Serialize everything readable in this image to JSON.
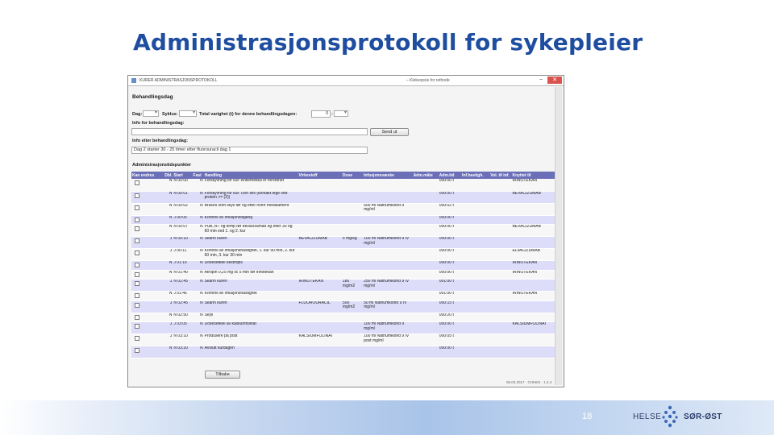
{
  "slide": {
    "title": "Administrasjonsprotokoll for sykepleier",
    "page_number": "18",
    "logo_left": "HELSE",
    "logo_right": "SØR-ØST"
  },
  "window": {
    "title": "KURER ADMINISTRASJONSPROTOKOLL",
    "subtitle": "– Kleksopsis for rethode",
    "minimize": "–",
    "close": "✕"
  },
  "behandlingsdag": {
    "heading": "Behandlingsdag",
    "dag_label": "Dag:",
    "syklus_label": "Syklus:",
    "varighet_label": "Total varighet (t) for denne behandlingsdagen:",
    "varighet_hours": "0",
    "varighet_sep": ":",
    "info_label": "Info for behandlingsdag:",
    "send_button": "Send ut",
    "info_etter_label": "Info etter behandlingsdag:",
    "info_etter_value": "Dag 2 starter 30 - 25 timer etter fluorouracil dag 1"
  },
  "admin": {
    "heading": "Administrasjonstidspunkter",
    "columns": [
      "Kan endres",
      "Dbl.",
      "Start",
      "Fast",
      "Handling",
      "Virkestoff",
      "Dose",
      "Infusjonsvæske",
      "Adm.måte",
      "Adm.tid",
      "Inf.hastigh.",
      "Vol. til inf.",
      "Knyttet til"
    ],
    "rows": [
      {
        "dbl": "N",
        "start": "N 00:00",
        "fast": "N",
        "handling": "Forskyvning for kur: Antiemetika er forordnet",
        "virkestoff": "",
        "dose": "",
        "infusjon": "",
        "admtid": "000:00 t",
        "knyttet": "IRINOTEKAN"
      },
      {
        "dbl": "N",
        "start": "N 00:01",
        "fast": "N",
        "handling": "Forskyvning for kur: Urin stix (kontakt lege ved protein >= (2))",
        "virkestoff": "",
        "dose": "",
        "infusjon": "",
        "admtid": "000:00 t",
        "knyttet": "BEVACIZUMAB"
      },
      {
        "dbl": "N",
        "start": "N 00:02",
        "fast": "N",
        "handling": "Brukes som skyll før og etter hvert medikament",
        "virkestoff": "",
        "dose": "",
        "infusjon": "500 ml Natriumklorid 9 mg/ml",
        "admtid": "000:02 t",
        "knyttet": ""
      },
      {
        "dbl": "N",
        "start": "J 00:05",
        "fast": "N",
        "handling": "Kontroll av infusjonstilgang",
        "virkestoff": "",
        "dose": "",
        "infusjon": "",
        "admtid": "000:00 t",
        "knyttet": ""
      },
      {
        "dbl": "N",
        "start": "N 00:07",
        "fast": "N",
        "handling": "Puls, BT og temp før bevacizumab og etter 30 og 60 min ved 1. og 2. kur",
        "virkestoff": "",
        "dose": "",
        "infusjon": "",
        "admtid": "000:00 t",
        "knyttet": "BEVACIZUMAB"
      },
      {
        "dbl": "J",
        "start": "N 00:10",
        "fast": "N",
        "handling": "Skann kuren",
        "virkestoff": "BEVACIZUMAB",
        "dose": "5 mg/kg",
        "infusjon": "100 ml Natriumklorid 9 IV mg/ml",
        "admtid": "000:00 t",
        "knyttet": ""
      },
      {
        "dbl": "J",
        "start": "J 00:11",
        "fast": "N",
        "handling": "Kontroll av infusjonshastighet, 1. kur 90 min, 2. kur 60 min, 3. kur 30 min",
        "virkestoff": "",
        "dose": "",
        "infusjon": "",
        "admtid": "000:00 t",
        "knyttet": "ELVACIZUMAB"
      },
      {
        "dbl": "N",
        "start": "J 01:15",
        "fast": "N",
        "handling": "Dosesetkeil ekstropis",
        "virkestoff": "",
        "dose": "",
        "infusjon": "",
        "admtid": "000:00 t",
        "knyttet": "IRINOTEKAN"
      },
      {
        "dbl": "N",
        "start": "N 01:40",
        "fast": "N",
        "handling": "Atropin 0,25 mg sc 5 min før irinotekan",
        "virkestoff": "",
        "dose": "",
        "infusjon": "",
        "admtid": "000:00 t",
        "knyttet": "IRINOTEKAN"
      },
      {
        "dbl": "J",
        "start": "N 01:45",
        "fast": "N",
        "handling": "Skann kuren",
        "virkestoff": "IRINOTEKAN",
        "dose": "180 mg/m2",
        "infusjon": "250 ml Natriumklorid 9 IV mg/ml",
        "admtid": "001:00 t",
        "knyttet": ""
      },
      {
        "dbl": "N",
        "start": "J 01:46",
        "fast": "N",
        "handling": "Kontroll av infusjonshastighet",
        "virkestoff": "",
        "dose": "",
        "infusjon": "",
        "admtid": "001:00 t",
        "knyttet": "IRINOTEKAN"
      },
      {
        "dbl": "J",
        "start": "N 02:45",
        "fast": "N",
        "handling": "Skann kuren",
        "virkestoff": "FLUOROURACIL",
        "dose": "500 mg/m2",
        "infusjon": "50 ml Natriumklorid 9 IV mg/ml",
        "admtid": "000:15 t",
        "knyttet": ""
      },
      {
        "dbl": "N",
        "start": "N 02:50",
        "fast": "N",
        "handling": "Skyll",
        "virkestoff": "",
        "dose": "",
        "infusjon": "",
        "admtid": "000:20 t",
        "knyttet": ""
      },
      {
        "dbl": "J",
        "start": "J 03:05",
        "fast": "N",
        "handling": "Dosesetkeil av kalsiumfolinat",
        "virkestoff": "",
        "dose": "",
        "infusjon": "100 ml Natriumklorid 9 mg/ml",
        "admtid": "000:00 t",
        "knyttet": "KALSIUMFOLINAT"
      },
      {
        "dbl": "J",
        "start": "N 03:10",
        "fast": "N",
        "handling": "Produsere på post",
        "virkestoff": "KALSIUMFOLINAT",
        "dose": "",
        "infusjon": "100 ml Natriumklorid 9 IV post mg/ml",
        "admtid": "000:05 t",
        "knyttet": ""
      },
      {
        "dbl": "N",
        "start": "N 03:20",
        "fast": "N",
        "handling": "Avslutt kurdagen",
        "virkestoff": "",
        "dose": "",
        "infusjon": "",
        "admtid": "000:00 t",
        "knyttet": ""
      }
    ],
    "back_button": "Tilbake",
    "status_text": "06.02.2017 · CHHES · 1.2.4"
  },
  "colors": {
    "title_blue": "#1f4ea1",
    "header_purple": "#6b6fb7",
    "row_alt": "#ddddfa",
    "row_normal": "#f7f7f7"
  }
}
